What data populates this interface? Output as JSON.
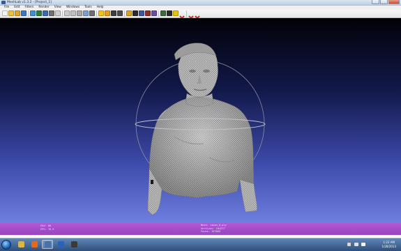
{
  "window": {
    "title": "MeshLab v1.3.2 - [Project_1]"
  },
  "menu": [
    "File",
    "Edit",
    "Filters",
    "Render",
    "View",
    "Windows",
    "Tools",
    "Help"
  ],
  "toolbar_icons": [
    {
      "name": "new-project-icon",
      "color": "#f4f4f4"
    },
    {
      "name": "open-icon",
      "color": "#e9c23a"
    },
    {
      "name": "open-folder-icon",
      "color": "#e0a526"
    },
    {
      "name": "import-mesh-icon",
      "color": "#3b77c9"
    },
    {
      "name": "reload-icon",
      "color": "#3f8fd4"
    },
    {
      "name": "reload-all-icon",
      "color": "#2c7a3e"
    },
    {
      "name": "save-icon",
      "color": "#3a6ab0"
    },
    {
      "name": "snapshot-icon",
      "color": "#707070"
    },
    {
      "name": "render-points-icon",
      "color": "#cfcfcf"
    },
    {
      "name": "render-wire-icon",
      "color": "#c9c9c9"
    },
    {
      "name": "render-hidden-icon",
      "color": "#bfbfbf"
    },
    {
      "name": "render-flat-icon",
      "color": "#a8a8a8"
    },
    {
      "name": "render-smooth-icon",
      "color": "#7ea0cc"
    },
    {
      "name": "render-texture-icon",
      "color": "#6e6e6e"
    },
    {
      "name": "lighting-icon",
      "color": "#f0c419"
    },
    {
      "name": "backface-icon",
      "color": "#e49d1c"
    },
    {
      "name": "color-icon",
      "color": "#3e3e3e"
    },
    {
      "name": "show-layers-icon",
      "color": "#4a4a4a"
    },
    {
      "name": "measure-icon",
      "color": "#d6a227"
    },
    {
      "name": "pick-points-icon",
      "color": "#2b2b2b"
    },
    {
      "name": "manipulator-icon",
      "color": "#38589a"
    },
    {
      "name": "select-faces-icon",
      "color": "#8e2d2d"
    },
    {
      "name": "select-vertices-icon",
      "color": "#6b4d9e"
    },
    {
      "name": "select-connected-icon",
      "color": "#3d6a3d"
    },
    {
      "name": "paint-icon",
      "color": "#2b2b2b"
    },
    {
      "name": "info-icon",
      "color": "#e5c400"
    },
    {
      "name": "delete-faces-icon",
      "color": "#d01818"
    },
    {
      "name": "delete-vertices-icon",
      "color": "#cc1d1d"
    },
    {
      "name": "delete-all-icon",
      "color": "#c21b1b"
    }
  ],
  "status": {
    "left": [
      "FOV: 60",
      "FPS:   76.9"
    ],
    "center": [
      "Mesh: raven_0.ply",
      "Vertices: 104277",
      "Faces: 197683"
    ]
  },
  "taskbar": {
    "apps": [
      {
        "name": "explorer",
        "color": "#d8b64a",
        "active": false
      },
      {
        "name": "firefox",
        "color": "#e06a1f",
        "active": false
      },
      {
        "name": "meshlab",
        "color": "#4b6fa8",
        "active": true
      },
      {
        "name": "photoshop",
        "color": "#2a63b7",
        "active": false
      },
      {
        "name": "terminal",
        "color": "#3a3a3a",
        "active": false
      }
    ],
    "clock_time": "1:22 AM",
    "clock_date": "1/28/2013"
  },
  "colors": {
    "viewport_top": "#020208",
    "viewport_bottom": "#6f7fe0",
    "status_bar": "#a84fcb"
  }
}
